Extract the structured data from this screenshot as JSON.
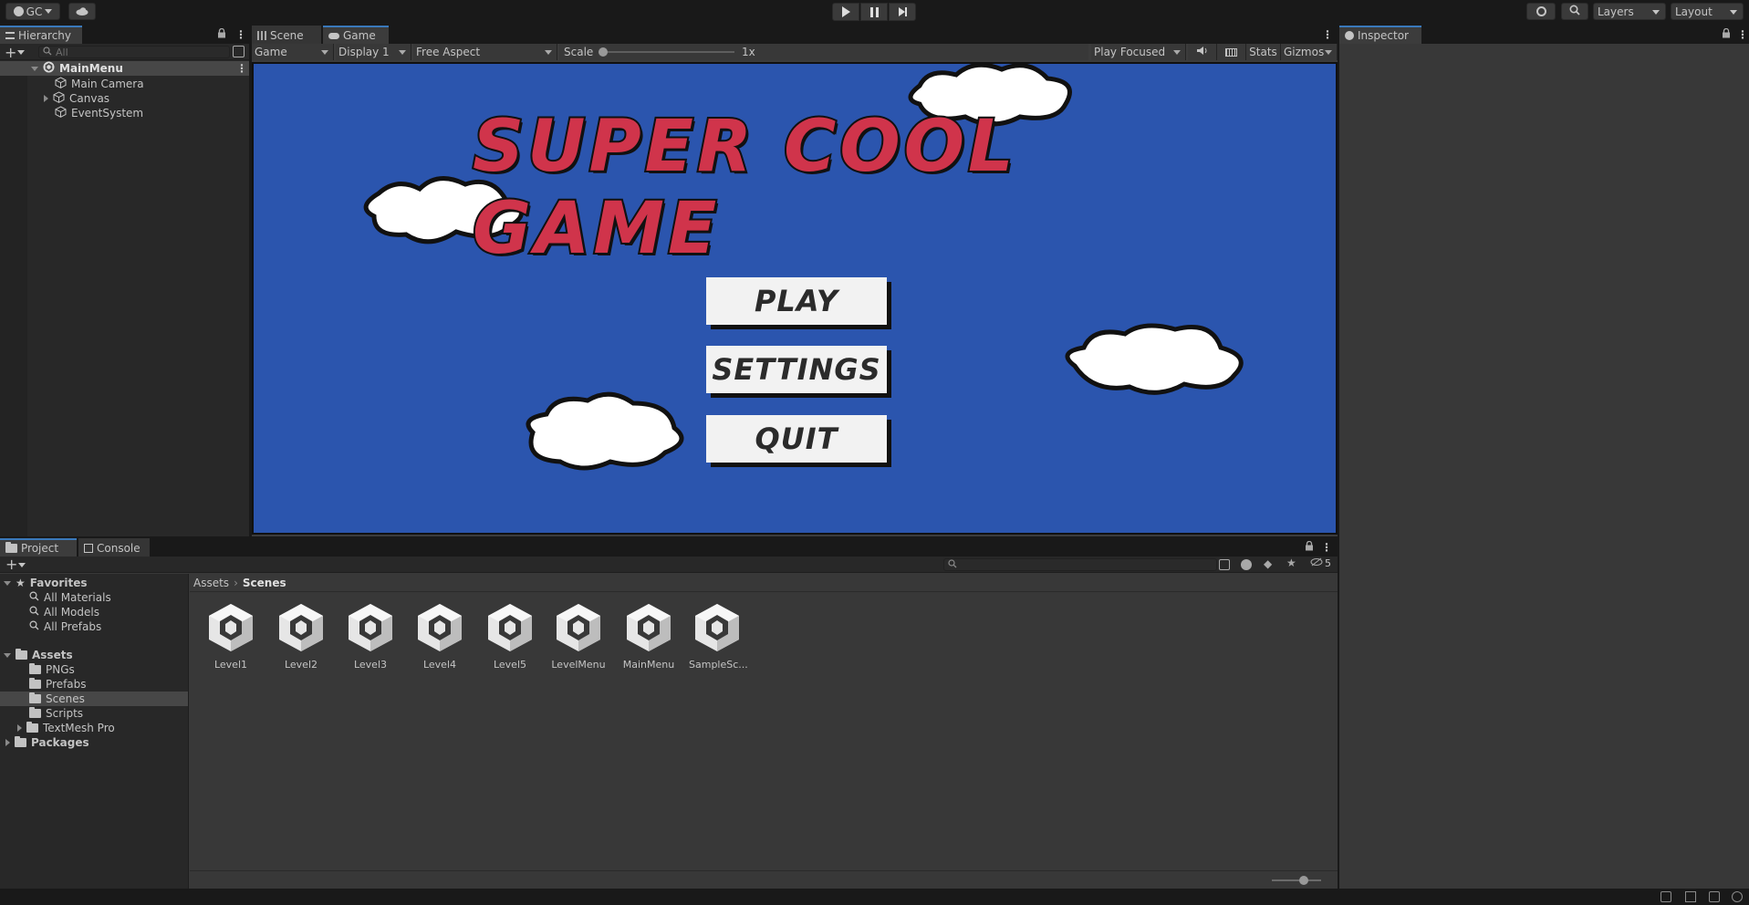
{
  "toolbar": {
    "account_label": "GC",
    "layers_label": "Layers",
    "layout_label": "Layout"
  },
  "hierarchy": {
    "tab_label": "Hierarchy",
    "search_placeholder": "All",
    "scene_name": "MainMenu",
    "items": [
      {
        "label": "Main Camera"
      },
      {
        "label": "Canvas"
      },
      {
        "label": "EventSystem"
      }
    ]
  },
  "view_tabs": {
    "scene_label": "Scene",
    "game_label": "Game"
  },
  "game_toolbar": {
    "mode": "Game",
    "display": "Display 1",
    "aspect": "Free Aspect",
    "scale_label": "Scale",
    "scale_value": "1x",
    "play_mode": "Play Focused",
    "stats_label": "Stats",
    "gizmos_label": "Gizmos"
  },
  "game_view": {
    "title": "SUPER COOL GAME",
    "buttons": [
      "PLAY",
      "SETTINGS",
      "QUIT"
    ],
    "bg_color": "#2b55ae",
    "title_color": "#d0344b"
  },
  "inspector": {
    "tab_label": "Inspector"
  },
  "bottom_tabs": {
    "project_label": "Project",
    "console_label": "Console"
  },
  "project": {
    "favorites_label": "Favorites",
    "favorites": [
      "All Materials",
      "All Models",
      "All Prefabs"
    ],
    "assets_label": "Assets",
    "asset_folders": [
      "PNGs",
      "Prefabs",
      "Scenes",
      "Scripts",
      "TextMesh Pro"
    ],
    "packages_label": "Packages",
    "breadcrumb_root": "Assets",
    "breadcrumb_current": "Scenes",
    "hidden_count": "5",
    "scenes": [
      "Level1",
      "Level2",
      "Level3",
      "Level4",
      "Level5",
      "LevelMenu",
      "MainMenu",
      "SampleSc..."
    ]
  }
}
